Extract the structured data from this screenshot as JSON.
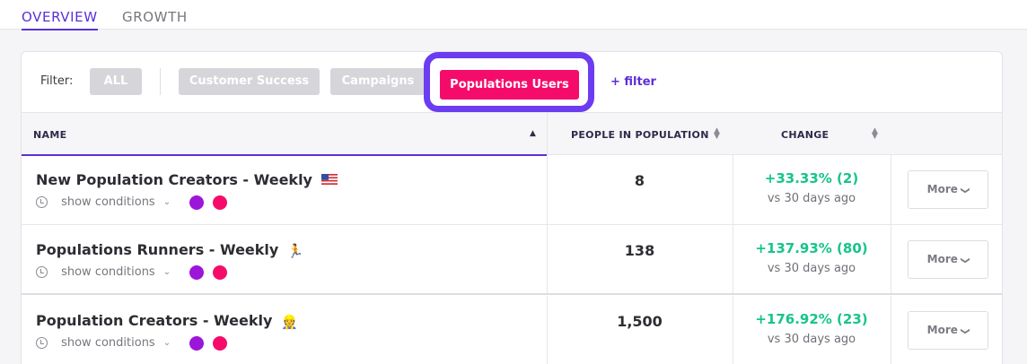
{
  "tabs": [
    {
      "label": "OVERVIEW",
      "active": true
    },
    {
      "label": "GROWTH",
      "active": false
    }
  ],
  "filter": {
    "label": "Filter:",
    "chips": {
      "all": "ALL",
      "customer_success": "Customer Success",
      "campaigns": "Campaigns",
      "populations_users": "Populations Users"
    },
    "add_filter": "+ filter"
  },
  "table": {
    "headers": {
      "name": "NAME",
      "people": "PEOPLE IN POPULATION",
      "change": "CHANGE"
    },
    "rows": [
      {
        "title": "New Population Creators - Weekly",
        "icon": "us-flag-icon",
        "conditions": "show conditions",
        "people": "8",
        "change": "+33.33% (2)",
        "change_sub": "vs 30 days ago",
        "more": "More"
      },
      {
        "title": "Populations Runners - Weekly",
        "icon": "runner-icon",
        "conditions": "show conditions",
        "people": "138",
        "change": "+137.93% (80)",
        "change_sub": "vs 30 days ago",
        "more": "More"
      },
      {
        "title": "Population Creators - Weekly",
        "icon": "construction-worker-icon",
        "conditions": "show conditions",
        "people": "1,500",
        "change": "+176.92% (23)",
        "change_sub": "vs 30 days ago",
        "more": "More"
      }
    ]
  },
  "colors": {
    "accent": "#5b2fd8",
    "highlight_ring": "#6b3cf0",
    "active_chip": "#f50c6b",
    "positive_change": "#17c48b",
    "dot_purple": "#9b16d9",
    "dot_pink": "#f50c6b"
  }
}
